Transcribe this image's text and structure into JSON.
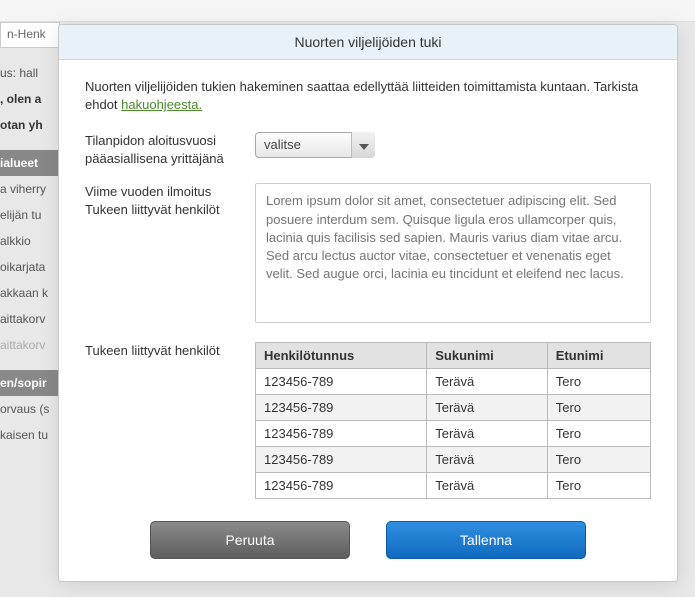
{
  "bg": {
    "strip": "n-Henk",
    "items": [
      {
        "text": "us:  hall",
        "cls": ""
      },
      {
        "text": ", olen a",
        "cls": "bold"
      },
      {
        "text": "otan yh",
        "cls": "bold"
      },
      {
        "text": "",
        "cls": ""
      },
      {
        "text": "ialueet",
        "cls": "heading"
      },
      {
        "text": "a viherry",
        "cls": ""
      },
      {
        "text": "elijän tu",
        "cls": ""
      },
      {
        "text": "alkkio",
        "cls": ""
      },
      {
        "text": "oikarjata",
        "cls": ""
      },
      {
        "text": "akkaan k",
        "cls": ""
      },
      {
        "text": "aittakorv",
        "cls": ""
      },
      {
        "text": "aittakorv",
        "cls": "faded"
      },
      {
        "text": "",
        "cls": ""
      },
      {
        "text": "en/sopir",
        "cls": "heading"
      },
      {
        "text": "orvaus (s",
        "cls": ""
      },
      {
        "text": "kaisen tu",
        "cls": ""
      }
    ]
  },
  "modal": {
    "title": "Nuorten viljelijöiden tuki",
    "intro_text": "Nuorten viljelijöiden tukien hakeminen saattaa edellyttää liitteiden toimittamista kuntaan. Tarkista ehdot ",
    "intro_link": "hakuohjeesta.",
    "field1_label": "Tilanpidon aloitusvuosi pääasiallisena yrittäjänä",
    "field1_value": "valitse",
    "field2_label_a": "Viime vuoden ilmoitus",
    "field2_label_b": "Tukeen liittyvät henkilöt",
    "field2_placeholder": "Lorem ipsum dolor sit amet, consectetuer adipiscing elit. Sed posuere interdum sem. Quisque ligula eros ullamcorper quis, lacinia quis facilisis sed sapien. Mauris varius diam vitae arcu. Sed arcu lectus auctor vitae, consectetuer et venenatis eget velit. Sed augue orci, lacinia eu tincidunt et eleifend nec lacus.",
    "table_label": "Tukeen liittyvät henkilöt",
    "table": {
      "headers": [
        "Henkilötunnus",
        "Sukunimi",
        "Etunimi"
      ],
      "rows": [
        [
          "123456-789",
          "Terävä",
          "Tero"
        ],
        [
          "123456-789",
          "Terävä",
          "Tero"
        ],
        [
          "123456-789",
          "Terävä",
          "Tero"
        ],
        [
          "123456-789",
          "Terävä",
          "Tero"
        ],
        [
          "123456-789",
          "Terävä",
          "Tero"
        ]
      ]
    },
    "cancel_label": "Peruuta",
    "save_label": "Tallenna"
  }
}
